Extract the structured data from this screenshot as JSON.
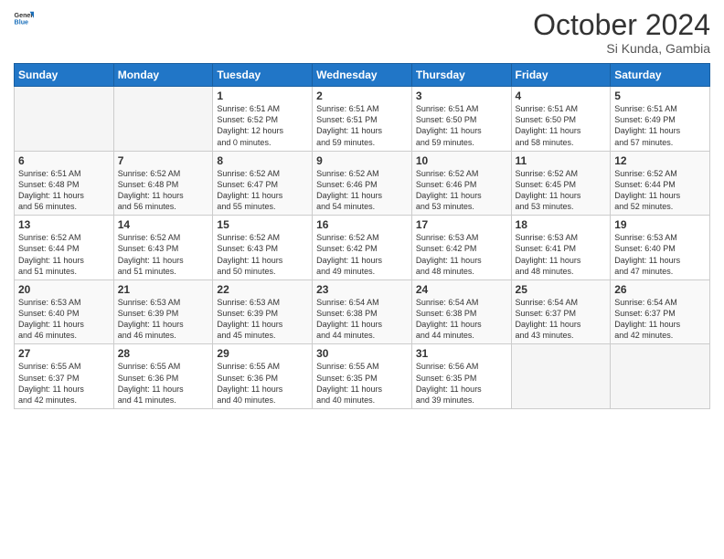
{
  "logo": {
    "line1": "General",
    "line2": "Blue"
  },
  "title": "October 2024",
  "subtitle": "Si Kunda, Gambia",
  "days_header": [
    "Sunday",
    "Monday",
    "Tuesday",
    "Wednesday",
    "Thursday",
    "Friday",
    "Saturday"
  ],
  "weeks": [
    [
      {
        "day": "",
        "info": ""
      },
      {
        "day": "",
        "info": ""
      },
      {
        "day": "1",
        "info": "Sunrise: 6:51 AM\nSunset: 6:52 PM\nDaylight: 12 hours\nand 0 minutes."
      },
      {
        "day": "2",
        "info": "Sunrise: 6:51 AM\nSunset: 6:51 PM\nDaylight: 11 hours\nand 59 minutes."
      },
      {
        "day": "3",
        "info": "Sunrise: 6:51 AM\nSunset: 6:50 PM\nDaylight: 11 hours\nand 59 minutes."
      },
      {
        "day": "4",
        "info": "Sunrise: 6:51 AM\nSunset: 6:50 PM\nDaylight: 11 hours\nand 58 minutes."
      },
      {
        "day": "5",
        "info": "Sunrise: 6:51 AM\nSunset: 6:49 PM\nDaylight: 11 hours\nand 57 minutes."
      }
    ],
    [
      {
        "day": "6",
        "info": "Sunrise: 6:51 AM\nSunset: 6:48 PM\nDaylight: 11 hours\nand 56 minutes."
      },
      {
        "day": "7",
        "info": "Sunrise: 6:52 AM\nSunset: 6:48 PM\nDaylight: 11 hours\nand 56 minutes."
      },
      {
        "day": "8",
        "info": "Sunrise: 6:52 AM\nSunset: 6:47 PM\nDaylight: 11 hours\nand 55 minutes."
      },
      {
        "day": "9",
        "info": "Sunrise: 6:52 AM\nSunset: 6:46 PM\nDaylight: 11 hours\nand 54 minutes."
      },
      {
        "day": "10",
        "info": "Sunrise: 6:52 AM\nSunset: 6:46 PM\nDaylight: 11 hours\nand 53 minutes."
      },
      {
        "day": "11",
        "info": "Sunrise: 6:52 AM\nSunset: 6:45 PM\nDaylight: 11 hours\nand 53 minutes."
      },
      {
        "day": "12",
        "info": "Sunrise: 6:52 AM\nSunset: 6:44 PM\nDaylight: 11 hours\nand 52 minutes."
      }
    ],
    [
      {
        "day": "13",
        "info": "Sunrise: 6:52 AM\nSunset: 6:44 PM\nDaylight: 11 hours\nand 51 minutes."
      },
      {
        "day": "14",
        "info": "Sunrise: 6:52 AM\nSunset: 6:43 PM\nDaylight: 11 hours\nand 51 minutes."
      },
      {
        "day": "15",
        "info": "Sunrise: 6:52 AM\nSunset: 6:43 PM\nDaylight: 11 hours\nand 50 minutes."
      },
      {
        "day": "16",
        "info": "Sunrise: 6:52 AM\nSunset: 6:42 PM\nDaylight: 11 hours\nand 49 minutes."
      },
      {
        "day": "17",
        "info": "Sunrise: 6:53 AM\nSunset: 6:42 PM\nDaylight: 11 hours\nand 48 minutes."
      },
      {
        "day": "18",
        "info": "Sunrise: 6:53 AM\nSunset: 6:41 PM\nDaylight: 11 hours\nand 48 minutes."
      },
      {
        "day": "19",
        "info": "Sunrise: 6:53 AM\nSunset: 6:40 PM\nDaylight: 11 hours\nand 47 minutes."
      }
    ],
    [
      {
        "day": "20",
        "info": "Sunrise: 6:53 AM\nSunset: 6:40 PM\nDaylight: 11 hours\nand 46 minutes."
      },
      {
        "day": "21",
        "info": "Sunrise: 6:53 AM\nSunset: 6:39 PM\nDaylight: 11 hours\nand 46 minutes."
      },
      {
        "day": "22",
        "info": "Sunrise: 6:53 AM\nSunset: 6:39 PM\nDaylight: 11 hours\nand 45 minutes."
      },
      {
        "day": "23",
        "info": "Sunrise: 6:54 AM\nSunset: 6:38 PM\nDaylight: 11 hours\nand 44 minutes."
      },
      {
        "day": "24",
        "info": "Sunrise: 6:54 AM\nSunset: 6:38 PM\nDaylight: 11 hours\nand 44 minutes."
      },
      {
        "day": "25",
        "info": "Sunrise: 6:54 AM\nSunset: 6:37 PM\nDaylight: 11 hours\nand 43 minutes."
      },
      {
        "day": "26",
        "info": "Sunrise: 6:54 AM\nSunset: 6:37 PM\nDaylight: 11 hours\nand 42 minutes."
      }
    ],
    [
      {
        "day": "27",
        "info": "Sunrise: 6:55 AM\nSunset: 6:37 PM\nDaylight: 11 hours\nand 42 minutes."
      },
      {
        "day": "28",
        "info": "Sunrise: 6:55 AM\nSunset: 6:36 PM\nDaylight: 11 hours\nand 41 minutes."
      },
      {
        "day": "29",
        "info": "Sunrise: 6:55 AM\nSunset: 6:36 PM\nDaylight: 11 hours\nand 40 minutes."
      },
      {
        "day": "30",
        "info": "Sunrise: 6:55 AM\nSunset: 6:35 PM\nDaylight: 11 hours\nand 40 minutes."
      },
      {
        "day": "31",
        "info": "Sunrise: 6:56 AM\nSunset: 6:35 PM\nDaylight: 11 hours\nand 39 minutes."
      },
      {
        "day": "",
        "info": ""
      },
      {
        "day": "",
        "info": ""
      }
    ]
  ]
}
